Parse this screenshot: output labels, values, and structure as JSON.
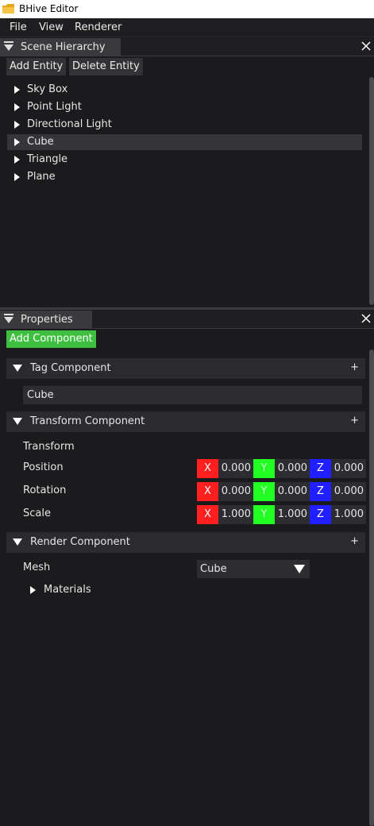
{
  "window": {
    "title": "BHive Editor"
  },
  "menu": {
    "file": "File",
    "view": "View",
    "renderer": "Renderer"
  },
  "hierarchy": {
    "title": "Scene Hierarchy",
    "add_button": "Add Entity",
    "delete_button": "Delete Entity",
    "entities": [
      "Sky Box",
      "Point Light",
      "Directional Light",
      "Cube",
      "Triangle",
      "Plane"
    ],
    "selected": "Cube"
  },
  "properties": {
    "title": "Properties",
    "add_component_button": "Add Component",
    "plus": "+",
    "tag": {
      "header": "Tag Component",
      "value": "Cube"
    },
    "transform": {
      "header": "Transform Component",
      "section_label": "Transform",
      "position_label": "Position",
      "rotation_label": "Rotation",
      "scale_label": "Scale",
      "axis_x": "X",
      "axis_y": "Y",
      "axis_z": "Z",
      "position": {
        "x": "0.000",
        "y": "0.000",
        "z": "0.000"
      },
      "rotation": {
        "x": "0.000",
        "y": "0.000",
        "z": "0.000"
      },
      "scale": {
        "x": "1.000",
        "y": "1.000",
        "z": "1.000"
      }
    },
    "render": {
      "header": "Render Component",
      "mesh_label": "Mesh",
      "mesh_value": "Cube",
      "materials_label": "Materials"
    }
  },
  "colors": {
    "accent_green": "#3fbf3f",
    "axis_x": "#ff1f1f",
    "axis_y": "#22ff22",
    "axis_z": "#1f1fff"
  }
}
